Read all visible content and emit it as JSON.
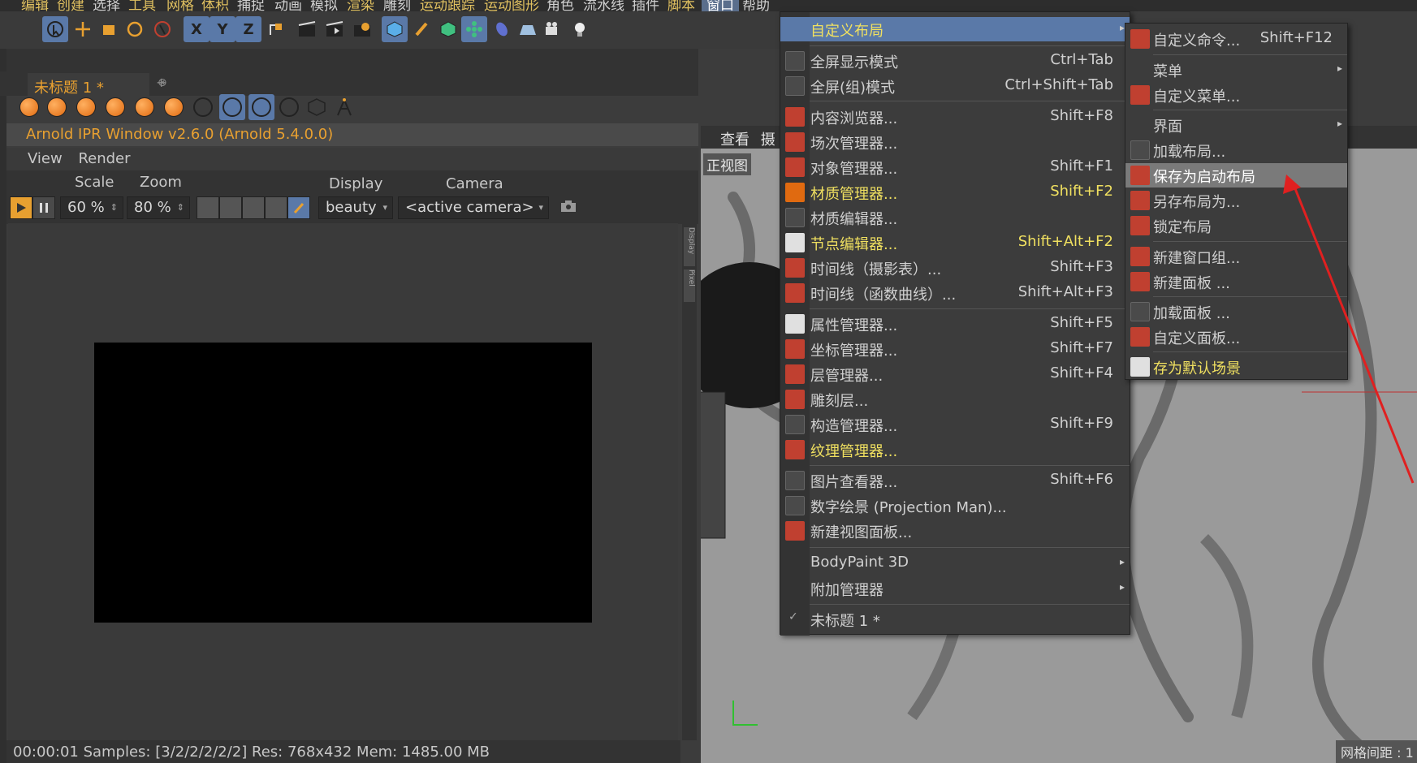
{
  "menubar": {
    "items": [
      "编辑",
      "创建",
      "选择",
      "工具",
      "网格",
      "体积",
      "捕捉",
      "动画",
      "模拟",
      "渲染",
      "雕刻",
      "运动跟踪",
      "运动图形",
      "角色",
      "流水线",
      "插件",
      "脚本",
      "窗口",
      "帮助"
    ],
    "active": "窗口"
  },
  "toolbar": {
    "axis_x": "X",
    "axis_y": "Y",
    "axis_z": "Z"
  },
  "tabs": {
    "active_label": "未标题 1 *",
    "close_glyph": "⊗",
    "add_glyph": "+"
  },
  "ipr": {
    "title": "Arnold IPR Window v2.6.0 (Arnold 5.4.0.0)",
    "menu": [
      "View",
      "Render"
    ],
    "scale_label": "Scale",
    "zoom_label": "Zoom",
    "display_label": "Display",
    "camera_label": "Camera",
    "scale_value": "60 %",
    "zoom_value": "80 %",
    "display_value": "beauty",
    "camera_value": "<active camera>",
    "side_tabs": [
      "Display",
      "Pixel"
    ],
    "status": "00:00:01  Samples: [3/2/2/2/2/2]  Res: 768x432  Mem: 1485.00 MB"
  },
  "viewport": {
    "header": [
      "查看",
      "摄"
    ],
    "label": "正视图",
    "grid_label": "网格间距 : 1"
  },
  "window_menu": {
    "items": [
      {
        "label": "自定义布局",
        "shortcut": "",
        "submenu": true
      },
      {
        "label": "全屏显示模式",
        "shortcut": "Ctrl+Tab"
      },
      {
        "label": "全屏(组)模式",
        "shortcut": "Ctrl+Shift+Tab"
      },
      {
        "label": "内容浏览器...",
        "shortcut": "Shift+F8"
      },
      {
        "label": "场次管理器...",
        "shortcut": ""
      },
      {
        "label": "对象管理器...",
        "shortcut": "Shift+F1"
      },
      {
        "label": "材质管理器...",
        "shortcut": "Shift+F2"
      },
      {
        "label": "材质编辑器...",
        "shortcut": ""
      },
      {
        "label": "节点编辑器...",
        "shortcut": "Shift+Alt+F2"
      },
      {
        "label": "时间线（摄影表）...",
        "shortcut": "Shift+F3"
      },
      {
        "label": "时间线（函数曲线）...",
        "shortcut": "Shift+Alt+F3"
      },
      {
        "label": "属性管理器...",
        "shortcut": "Shift+F5"
      },
      {
        "label": "坐标管理器...",
        "shortcut": "Shift+F7"
      },
      {
        "label": "层管理器...",
        "shortcut": "Shift+F4"
      },
      {
        "label": "雕刻层...",
        "shortcut": ""
      },
      {
        "label": "构造管理器...",
        "shortcut": "Shift+F9"
      },
      {
        "label": "纹理管理器...",
        "shortcut": ""
      },
      {
        "label": "图片查看器...",
        "shortcut": "Shift+F6"
      },
      {
        "label": "数字绘景 (Projection Man)...",
        "shortcut": ""
      },
      {
        "label": "新建视图面板...",
        "shortcut": ""
      },
      {
        "label": "BodyPaint 3D",
        "shortcut": "",
        "submenu": true
      },
      {
        "label": "附加管理器",
        "shortcut": "",
        "submenu": true
      },
      {
        "label": "未标题 1 *",
        "shortcut": "",
        "check": "✓"
      }
    ]
  },
  "layout_submenu": {
    "items": [
      {
        "label": "自定义命令...",
        "shortcut": "Shift+F12"
      },
      {
        "label": "菜单",
        "submenu": true
      },
      {
        "label": "自定义菜单..."
      },
      {
        "label": "界面",
        "submenu": true
      },
      {
        "label": "加载布局..."
      },
      {
        "label": "保存为启动布局"
      },
      {
        "label": "另存布局为..."
      },
      {
        "label": "锁定布局"
      },
      {
        "label": "新建窗口组..."
      },
      {
        "label": "新建面板 ..."
      },
      {
        "label": "加载面板 ..."
      },
      {
        "label": "自定义面板..."
      },
      {
        "label": "存为默认场景"
      }
    ]
  },
  "colors": {
    "accent": "#5a79a8",
    "highlight_text": "#f0e060",
    "arrow": "#e02020"
  }
}
